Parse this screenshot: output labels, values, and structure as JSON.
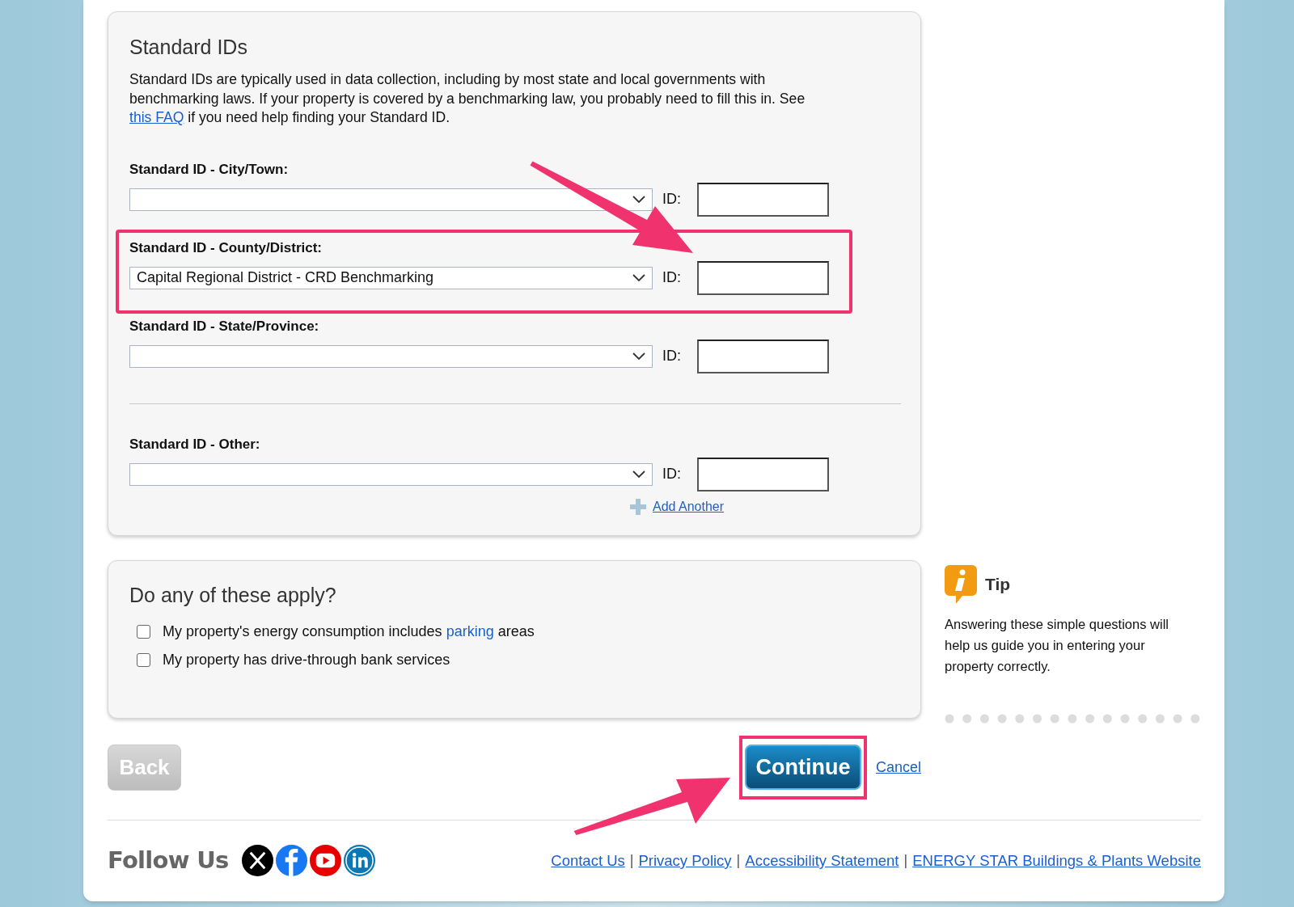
{
  "standard_ids": {
    "title": "Standard IDs",
    "intro": {
      "before": "Standard IDs are typically used in data collection, including by most state and local governments with benchmarking laws. If your property is covered by a benchmarking law, you probably need to fill this in. See",
      "link": "this FAQ",
      "after": "if you need help finding your Standard ID."
    },
    "rows": [
      {
        "label": "Standard ID - City/Town:",
        "value": "",
        "id_label": "ID:",
        "highlighted": false,
        "divider_before": false
      },
      {
        "label": "Standard ID - County/District:",
        "value": "Capital Regional District - CRD Benchmarking",
        "id_label": "ID:",
        "highlighted": true,
        "divider_before": false
      },
      {
        "label": "Standard ID - State/Province:",
        "value": "",
        "id_label": "ID:",
        "highlighted": false,
        "divider_before": false
      },
      {
        "label": "Standard ID - Other:",
        "value": "",
        "id_label": "ID:",
        "highlighted": false,
        "divider_before": true
      }
    ],
    "add_another": "Add Another"
  },
  "questions": {
    "title": "Do any of these apply?",
    "items": [
      {
        "before": "My property's energy consumption includes",
        "link": "parking",
        "after": "areas",
        "checked": false
      },
      {
        "before": "My property has drive-through bank services",
        "checked": false
      }
    ]
  },
  "tip": {
    "title": "Tip",
    "text": "Answering these simple questions will help us guide you in entering your property correctly."
  },
  "actions": {
    "back": {
      "label": "Back",
      "disabled": true
    },
    "continue": {
      "label": "Continue",
      "highlighted": true
    },
    "cancel": "Cancel"
  },
  "footer": {
    "follow_us": "Follow Us",
    "links": [
      "Contact Us",
      "Privacy Policy",
      "Accessibility Statement",
      "ENERGY STAR Buildings & Plants Website"
    ],
    "separator": "|"
  }
}
